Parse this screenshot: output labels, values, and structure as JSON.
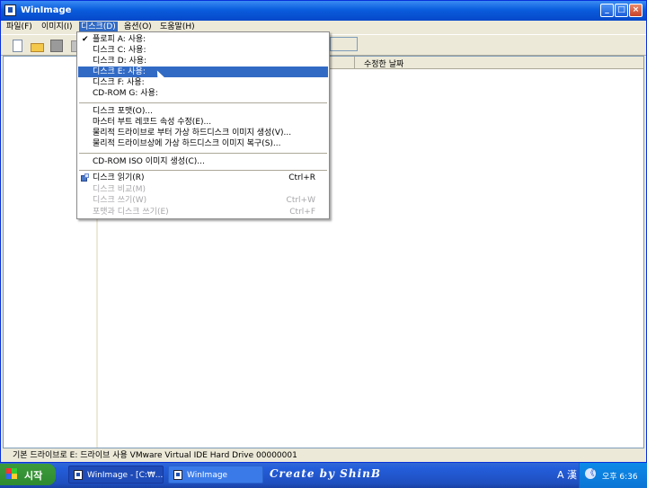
{
  "window": {
    "title": "WinImage"
  },
  "titlebar_buttons": {
    "minimize": "_",
    "maximize": "□",
    "close": "×"
  },
  "menubar": [
    {
      "label": "파일(F)"
    },
    {
      "label": "이미지(I)"
    },
    {
      "label": "디스크(D)"
    },
    {
      "label": "옵션(O)"
    },
    {
      "label": "도움말(H)"
    }
  ],
  "list_header": {
    "modified_date": "수정한 날짜"
  },
  "disk_menu": {
    "drives": [
      {
        "label": "플로피 A: 사용:",
        "checked": true
      },
      {
        "label": "디스크 C: 사용:"
      },
      {
        "label": "디스크 D: 사용:"
      },
      {
        "label": "디스크 E: 사용:",
        "highlighted": true
      },
      {
        "label": "디스크 F: 사용:"
      },
      {
        "label": "CD-ROM G: 사용:"
      }
    ],
    "checkmark": "✔",
    "actions": [
      {
        "label": "디스크 포맷(O)..."
      },
      {
        "label": "마스터 부트 레코드 속성 수정(E)..."
      },
      {
        "label": "물리적 드라이브로 부터 가상 하드디스크 이미지 생성(V)..."
      },
      {
        "label": "물리적 드라이브상에 가상 하드디스크 이미지 복구(S)..."
      }
    ],
    "iso": {
      "label": "CD-ROM ISO 이미지 생성(C)..."
    },
    "disk_ops": [
      {
        "label": "디스크 읽기(R)",
        "shortcut": "Ctrl+R",
        "icon": "read-disk-icon"
      },
      {
        "label": "디스크 비교(M)",
        "shortcut": "",
        "disabled": true
      },
      {
        "label": "디스크 쓰기(W)",
        "shortcut": "Ctrl+W",
        "disabled": true
      },
      {
        "label": "포맷과 디스크 쓰기(E)",
        "shortcut": "Ctrl+F",
        "disabled": true
      }
    ]
  },
  "statusbar": {
    "text": "기본 드라이브로 E: 드라이브 사용 VMware Virtual IDE Hard Drive 00000001"
  },
  "taskbar": {
    "start_label": "시작",
    "tasks": [
      {
        "label": "WinImage - [C:₩..."
      },
      {
        "label": "WinImage"
      }
    ],
    "brand_text": "Create by ShinB",
    "ime_text": "A 漢",
    "tray_bubble": "《",
    "clock": "오후 6:36"
  }
}
